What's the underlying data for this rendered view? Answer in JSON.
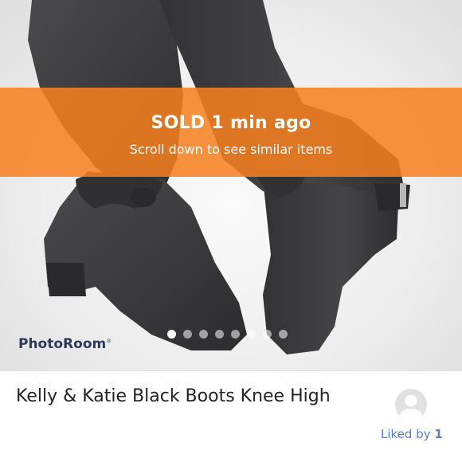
{
  "listing": {
    "sold_status": "SOLD 1 min ago",
    "sold_hint": "Scroll down to see similar items",
    "title": "Kelly & Katie Black Boots Knee High",
    "liked_by_label": "Liked by",
    "liked_by_count": "1"
  },
  "watermark": {
    "text": "PhotoRoom"
  },
  "carousel": {
    "total_images": 8,
    "active_index": 0
  },
  "colors": {
    "sold_banner": "#f7801e",
    "liked_link": "#5a7cc5",
    "watermark": "#2c3b5c"
  }
}
